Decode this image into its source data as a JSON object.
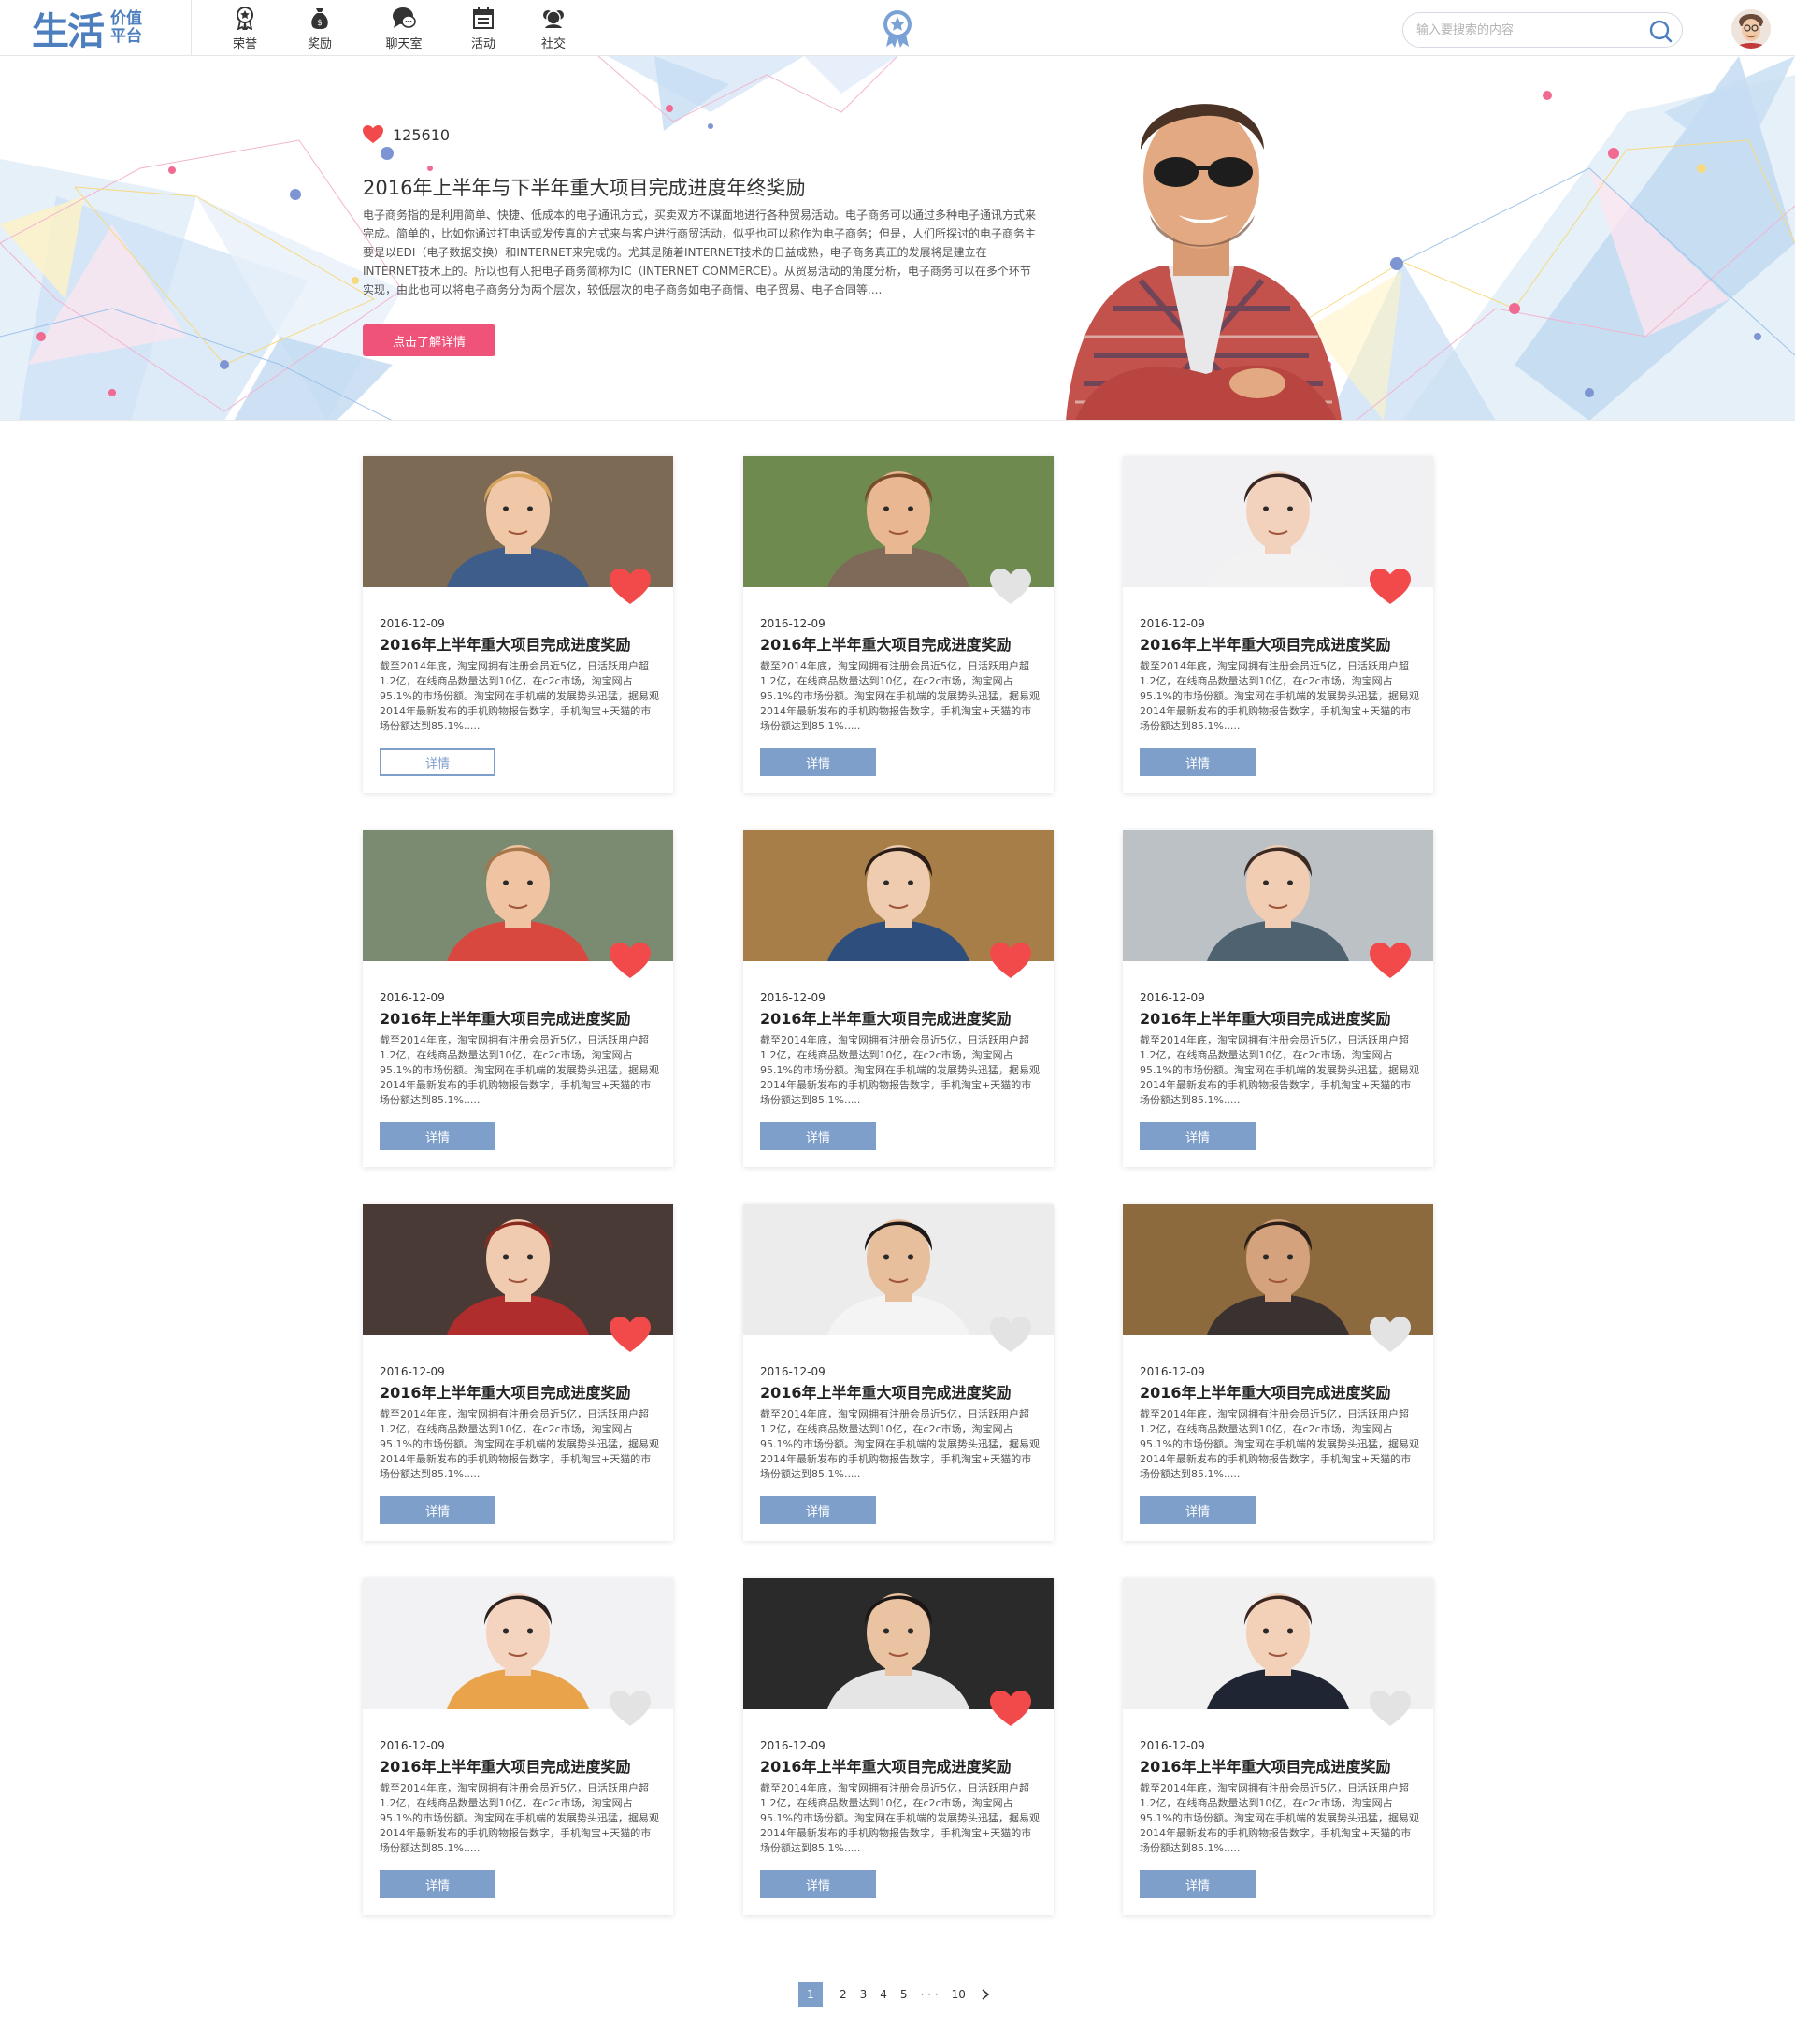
{
  "header": {
    "logo_main": "生活",
    "logo_sub_1": "价值",
    "logo_sub_2": "平台",
    "nav": [
      {
        "label": "荣誉",
        "icon": "medal-icon"
      },
      {
        "label": "奖励",
        "icon": "money-bag-icon"
      },
      {
        "label": "聊天室",
        "icon": "chat-icon"
      },
      {
        "label": "活动",
        "icon": "calendar-icon"
      },
      {
        "label": "社交",
        "icon": "social-icon"
      }
    ],
    "search_placeholder": "输入要搜索的内容"
  },
  "hero": {
    "likes": "125610",
    "title": "2016年上半年与下半年重大项目完成进度年终奖励",
    "description": "电子商务指的是利用简单、快捷、低成本的电子通讯方式，买卖双方不谋面地进行各种贸易活动。电子商务可以通过多种电子通讯方式来完成。简单的，比如你通过打电话或发传真的方式来与客户进行商贸活动，似乎也可以称作为电子商务；但是，人们所探讨的电子商务主要是以EDI（电子数据交换）和INTERNET来完成的。尤其是随着INTERNET技术的日益成熟，电子商务真正的发展将是建立在INTERNET技术上的。所以也有人把电子商务简称为IC（INTERNET COMMERCE）。从贸易活动的角度分析，电子商务可以在多个环节实现，由此也可以将电子商务分为两个层次，较低层次的电子商务如电子商情、电子贸易、电子合同等....",
    "button": "点击了解详情"
  },
  "cards": [
    {
      "date": "2016-12-09",
      "title": "2016年上半年重大项目完成进度奖励",
      "desc": "截至2014年底，淘宝网拥有注册会员近5亿，日活跃用户超1.2亿，在线商品数量达到10亿，在c2c市场，淘宝网占95.1%的市场份额。淘宝网在手机端的发展势头迅猛，据易观2014年最新发布的手机购物报告数字，手机淘宝+天猫的市场份额达到85.1%.....",
      "button": "详情",
      "liked": true
    },
    {
      "date": "2016-12-09",
      "title": "2016年上半年重大项目完成进度奖励",
      "desc": "截至2014年底，淘宝网拥有注册会员近5亿，日活跃用户超1.2亿，在线商品数量达到10亿，在c2c市场，淘宝网占95.1%的市场份额。淘宝网在手机端的发展势头迅猛，据易观2014年最新发布的手机购物报告数字，手机淘宝+天猫的市场份额达到85.1%.....",
      "button": "详情",
      "liked": false
    },
    {
      "date": "2016-12-09",
      "title": "2016年上半年重大项目完成进度奖励",
      "desc": "截至2014年底，淘宝网拥有注册会员近5亿，日活跃用户超1.2亿，在线商品数量达到10亿，在c2c市场，淘宝网占95.1%的市场份额。淘宝网在手机端的发展势头迅猛，据易观2014年最新发布的手机购物报告数字，手机淘宝+天猫的市场份额达到85.1%.....",
      "button": "详情",
      "liked": true
    },
    {
      "date": "2016-12-09",
      "title": "2016年上半年重大项目完成进度奖励",
      "desc": "截至2014年底，淘宝网拥有注册会员近5亿，日活跃用户超1.2亿，在线商品数量达到10亿，在c2c市场，淘宝网占95.1%的市场份额。淘宝网在手机端的发展势头迅猛，据易观2014年最新发布的手机购物报告数字，手机淘宝+天猫的市场份额达到85.1%.....",
      "button": "详情",
      "liked": true
    },
    {
      "date": "2016-12-09",
      "title": "2016年上半年重大项目完成进度奖励",
      "desc": "截至2014年底，淘宝网拥有注册会员近5亿，日活跃用户超1.2亿，在线商品数量达到10亿，在c2c市场，淘宝网占95.1%的市场份额。淘宝网在手机端的发展势头迅猛，据易观2014年最新发布的手机购物报告数字，手机淘宝+天猫的市场份额达到85.1%.....",
      "button": "详情",
      "liked": true
    },
    {
      "date": "2016-12-09",
      "title": "2016年上半年重大项目完成进度奖励",
      "desc": "截至2014年底，淘宝网拥有注册会员近5亿，日活跃用户超1.2亿，在线商品数量达到10亿，在c2c市场，淘宝网占95.1%的市场份额。淘宝网在手机端的发展势头迅猛，据易观2014年最新发布的手机购物报告数字，手机淘宝+天猫的市场份额达到85.1%.....",
      "button": "详情",
      "liked": true
    },
    {
      "date": "2016-12-09",
      "title": "2016年上半年重大项目完成进度奖励",
      "desc": "截至2014年底，淘宝网拥有注册会员近5亿，日活跃用户超1.2亿，在线商品数量达到10亿，在c2c市场，淘宝网占95.1%的市场份额。淘宝网在手机端的发展势头迅猛，据易观2014年最新发布的手机购物报告数字，手机淘宝+天猫的市场份额达到85.1%.....",
      "button": "详情",
      "liked": true
    },
    {
      "date": "2016-12-09",
      "title": "2016年上半年重大项目完成进度奖励",
      "desc": "截至2014年底，淘宝网拥有注册会员近5亿，日活跃用户超1.2亿，在线商品数量达到10亿，在c2c市场，淘宝网占95.1%的市场份额。淘宝网在手机端的发展势头迅猛，据易观2014年最新发布的手机购物报告数字，手机淘宝+天猫的市场份额达到85.1%.....",
      "button": "详情",
      "liked": false
    },
    {
      "date": "2016-12-09",
      "title": "2016年上半年重大项目完成进度奖励",
      "desc": "截至2014年底，淘宝网拥有注册会员近5亿，日活跃用户超1.2亿，在线商品数量达到10亿，在c2c市场，淘宝网占95.1%的市场份额。淘宝网在手机端的发展势头迅猛，据易观2014年最新发布的手机购物报告数字，手机淘宝+天猫的市场份额达到85.1%.....",
      "button": "详情",
      "liked": false
    },
    {
      "date": "2016-12-09",
      "title": "2016年上半年重大项目完成进度奖励",
      "desc": "截至2014年底，淘宝网拥有注册会员近5亿，日活跃用户超1.2亿，在线商品数量达到10亿，在c2c市场，淘宝网占95.1%的市场份额。淘宝网在手机端的发展势头迅猛，据易观2014年最新发布的手机购物报告数字，手机淘宝+天猫的市场份额达到85.1%.....",
      "button": "详情",
      "liked": false
    },
    {
      "date": "2016-12-09",
      "title": "2016年上半年重大项目完成进度奖励",
      "desc": "截至2014年底，淘宝网拥有注册会员近5亿，日活跃用户超1.2亿，在线商品数量达到10亿，在c2c市场，淘宝网占95.1%的市场份额。淘宝网在手机端的发展势头迅猛，据易观2014年最新发布的手机购物报告数字，手机淘宝+天猫的市场份额达到85.1%.....",
      "button": "详情",
      "liked": true
    },
    {
      "date": "2016-12-09",
      "title": "2016年上半年重大项目完成进度奖励",
      "desc": "截至2014年底，淘宝网拥有注册会员近5亿，日活跃用户超1.2亿，在线商品数量达到10亿，在c2c市场，淘宝网占95.1%的市场份额。淘宝网在手机端的发展势头迅猛，据易观2014年最新发布的手机购物报告数字，手机淘宝+天猫的市场份额达到85.1%.....",
      "button": "详情",
      "liked": false
    }
  ],
  "pagination": {
    "current": "1",
    "pages": [
      "2",
      "3",
      "4",
      "5"
    ],
    "ellipsis": "· · ·",
    "last": "10"
  },
  "colors": {
    "brand_blue": "#4d7fbf",
    "button_blue": "#7f9fcb",
    "hero_button_pink": "#f0537a",
    "heart_red": "#f24a4a",
    "heart_gray": "#e3e3e3"
  }
}
